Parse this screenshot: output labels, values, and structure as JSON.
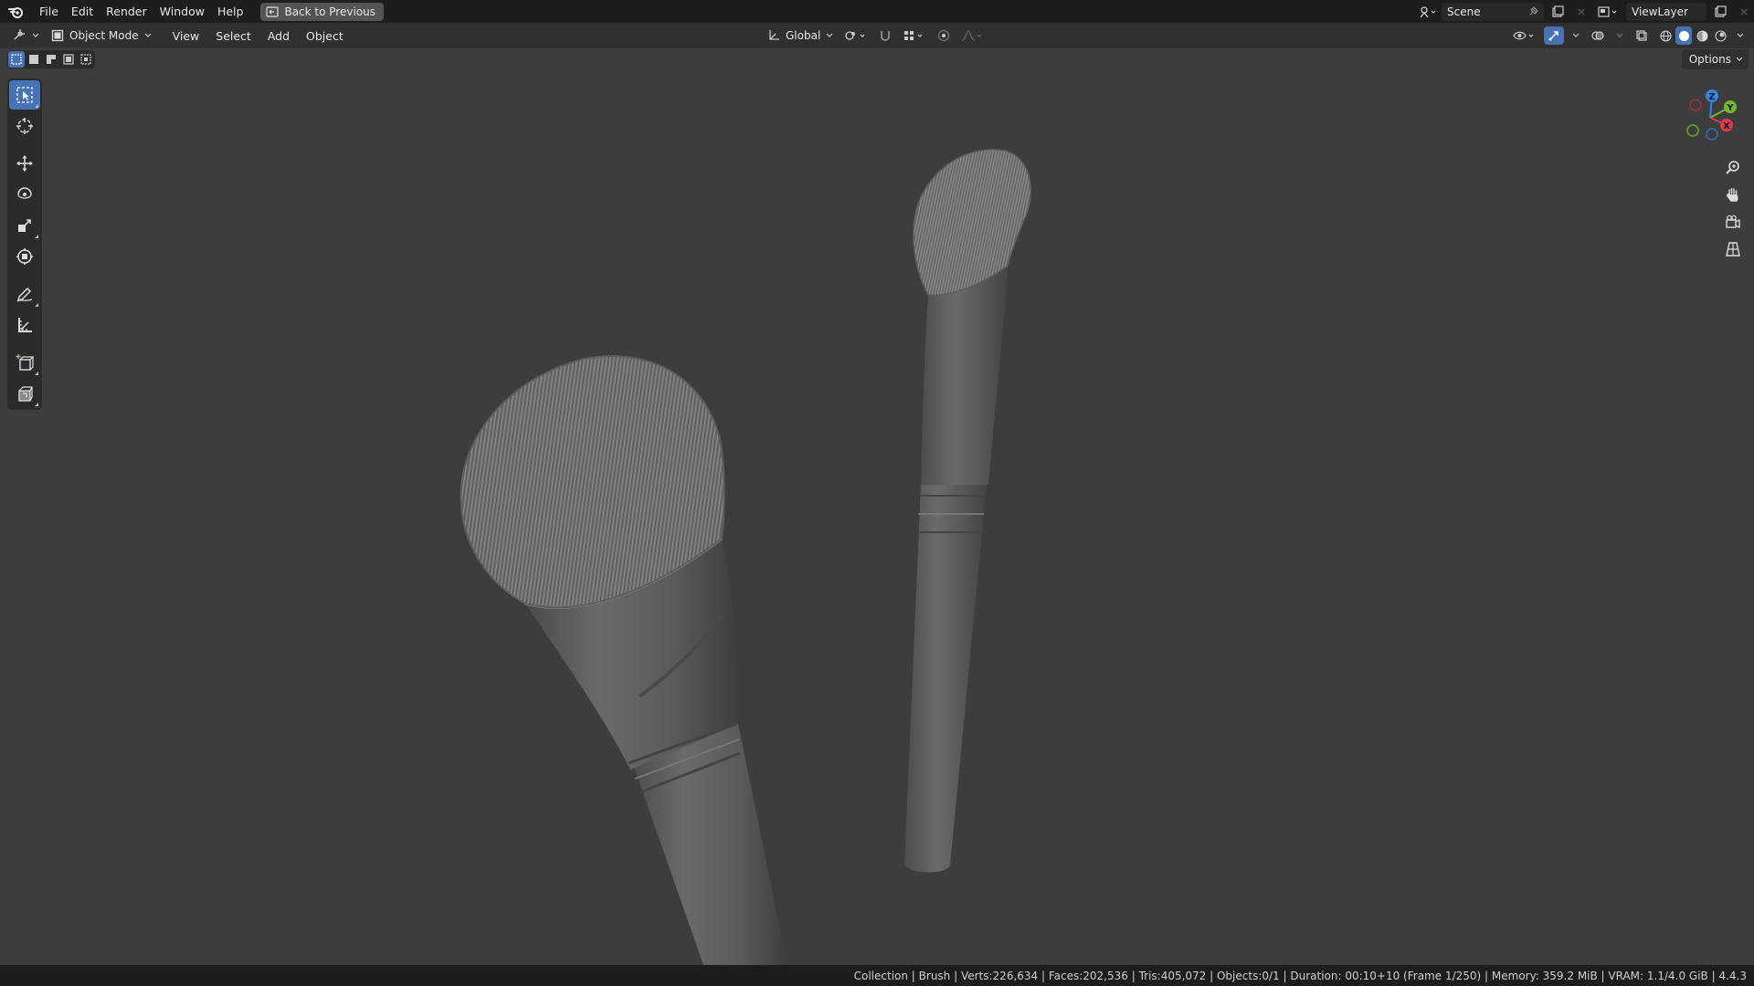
{
  "topbar": {
    "menus": [
      "File",
      "Edit",
      "Render",
      "Window",
      "Help"
    ],
    "back_button": "Back to Previous",
    "scene_name": "Scene",
    "view_layer": "ViewLayer"
  },
  "viewport_header": {
    "mode": "Object Mode",
    "menus": [
      "View",
      "Select",
      "Add",
      "Object"
    ],
    "transform_orientation": "Global",
    "options_label": "Options"
  },
  "toolbar": {
    "tools": [
      "select-box",
      "cursor",
      "move",
      "rotate",
      "scale",
      "transform",
      "annotate",
      "measure",
      "add-cube",
      "add-object"
    ],
    "active_tool": "select-box"
  },
  "gizmo": {
    "axes": [
      "X",
      "Y",
      "Z"
    ],
    "colors": {
      "x": "#e0384f",
      "y": "#73b82e",
      "z": "#2f87e3"
    }
  },
  "statusbar": {
    "text": "Collection | Brush | Verts:226,634 | Faces:202,536 | Tris:405,072 | Objects:0/1 | Duration: 00:10+10 (Frame 1/250) | Memory: 359.2 MiB | VRAM: 1.1/4.0 GiB | 4.4.3"
  },
  "colors": {
    "accent": "#4772b3",
    "background": "#3d3d3d"
  }
}
